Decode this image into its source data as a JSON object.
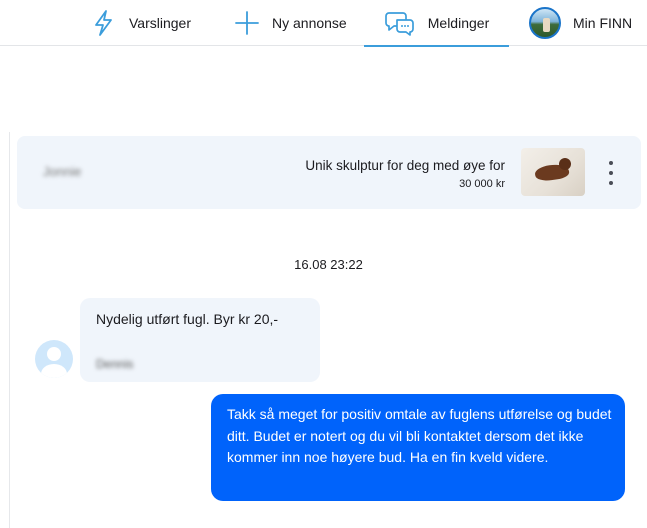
{
  "nav": {
    "items": [
      {
        "label": "Varslinger",
        "icon": "lightning-icon"
      },
      {
        "label": "Ny annonse",
        "icon": "plus-icon"
      },
      {
        "label": "Meldinger",
        "icon": "chat-bubbles-icon",
        "active": true
      },
      {
        "label": "Min FINN",
        "icon": "profile-avatar"
      }
    ]
  },
  "ad": {
    "user_name": "Jonnie",
    "title": "Unik skulptur for deg med øye for",
    "price": "30 000 kr",
    "menu_icon": "more-vertical-icon"
  },
  "conversation": {
    "timestamp": "16.08 23:22",
    "messages": [
      {
        "direction": "incoming",
        "text": "Nydelig utført fugl. Byr kr 20,-",
        "sender": "Dennis"
      },
      {
        "direction": "outgoing",
        "text": "Takk så meget for positiv omtale av fuglens utførelse og budet ditt. Budet er notert og du vil bli kontaktet dersom det ikke kommer inn noe høyere bud. Ha en fin kveld videre."
      }
    ]
  },
  "colors": {
    "accent": "#0063fb",
    "active_tab_underline": "#3b9ddb",
    "card_bg": "#f0f5fb",
    "icon_blue": "#3b9ddb"
  }
}
